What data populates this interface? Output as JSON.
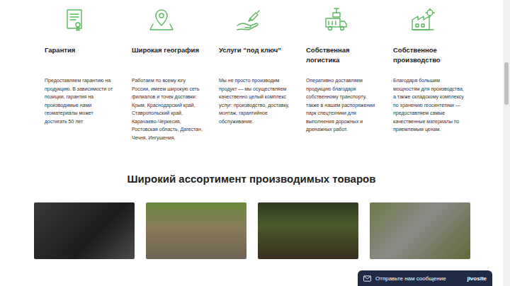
{
  "features": [
    {
      "title": "Гарантия",
      "text": "Предоставляем гарантию на продукцию. В зависимости от позиции, гарантия на производимые нами геоматериалы может достигать 50 лет",
      "icon": "certificate"
    },
    {
      "title": "Широкая география",
      "text": "Работаем по всему югу России, имеем широкую сеть филиалов и точек доставки: Крым, Краснодарский край, Ставропольский край, Карачаево-Черкесия, Ростовская область, Дагестан, Чечня, Ингушения.",
      "icon": "map"
    },
    {
      "title": "Услуги “под ключ”",
      "text": "Мы не просто производим продукт — мы осуществляем качественно целый комплекс услуг: производство, доставку, монтаж, гарантийное обслуживание.",
      "icon": "hand"
    },
    {
      "title": "Собственная логистика",
      "text": "Оперативно доставляем продукцию благодаря собственному транспорту, также в нашем распоряжении парк спецтехники для выполнения дорожных и дренажных работ.",
      "icon": "truck"
    },
    {
      "title": "Собственное производство",
      "text": "Благодаря большим мощностям для производства, а также складскому комплексу по хранению геосинтетики — предоставляем самые качественные материалы по приемлемым ценам.",
      "icon": "factory"
    }
  ],
  "section": {
    "title": "Широкий ассортимент производимых товаров"
  },
  "products": [
    {
      "kind": "geotextile"
    },
    {
      "kind": "gabion"
    },
    {
      "kind": "well"
    },
    {
      "kind": "grate"
    }
  ],
  "chat": {
    "label": "Отправьте нам сообщение",
    "brand": "jivosite"
  }
}
